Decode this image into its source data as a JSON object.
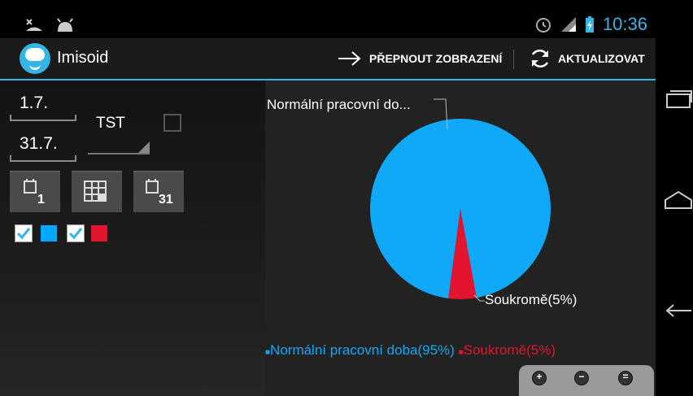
{
  "status_bar": {
    "time": "10:36"
  },
  "action_bar": {
    "app_title": "Imisoid",
    "switch_label": "PŘEPNOUT ZOBRAZENÍ",
    "refresh_label": "AKTUALIZOVAT"
  },
  "controls": {
    "date_from": "1.7.",
    "date_to": "31.7.",
    "spinner_value": "TST",
    "calendar_buttons": [
      {
        "icon": "calendar-day-icon",
        "number": "1"
      },
      {
        "icon": "calendar-week-icon",
        "number": ""
      },
      {
        "icon": "calendar-month-icon",
        "number": "31"
      }
    ],
    "legend_checkboxes": [
      {
        "checked": true,
        "color": "#00a8ff"
      },
      {
        "checked": true,
        "color": "#e3142d"
      }
    ]
  },
  "chart_data": {
    "type": "pie",
    "slices": [
      {
        "label": "Normální pracovní doba",
        "percent": 95,
        "color": "#11a8f7"
      },
      {
        "label": "Soukromě",
        "percent": 5,
        "color": "#e3142d"
      }
    ],
    "slice_labels": [
      "Normální pracovní do...",
      "Soukromě(5%)"
    ],
    "legend": [
      "Normální pracovní doba(95%)",
      "Soukromě(5%)"
    ],
    "legend_position": "bottom"
  },
  "zoom_controls": [
    "zoom-in-icon",
    "zoom-out-icon",
    "zoom-reset-icon"
  ],
  "colors": {
    "accent": "#33b5e5",
    "series_blue": "#11a8f7",
    "series_red": "#e3142d"
  }
}
